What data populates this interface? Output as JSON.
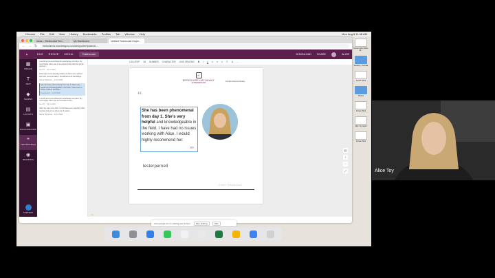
{
  "menubar": {
    "items": [
      "Chrome",
      "File",
      "Edit",
      "View",
      "History",
      "Bookmarks",
      "Profiles",
      "Tab",
      "Window",
      "Help"
    ],
    "clock": "Mon Aug 8 11:48 AM"
  },
  "browser": {
    "tabs": [
      "Ideas – Testimonial Tem...",
      "My Dashboard",
      "Untitled Testimonial Graph..."
    ],
    "url": "berkshirehs.maxdesigns.com/designs/template/d1..."
  },
  "app": {
    "menu": [
      "DNS",
      "RESIZE",
      "MEDIA"
    ],
    "design_name": "Testimonial",
    "right": [
      "DOWNLOAD",
      "SHARE",
      "ALICE"
    ]
  },
  "rail": {
    "items": [
      "IMAGES",
      "TEXT",
      "SHAPES",
      "LAYOUTS",
      "BACKGROUNDS",
      "TESTIMONIALS",
      "BRANDING"
    ],
    "active": "TESTIMONIALS",
    "bottom": "SUPPORT"
  },
  "panel": {
    "items": [
      {
        "text": "I would recommend Berkshire Hathaway and Alice Toy most highly. Alice was a tremendous help with the whole process...",
        "meta": "Jane R. · Jul 14 2022"
      },
      {
        "text": "Alice is the most amazing realtor we have ever worked with! Her communication, friendliness and knowledge...",
        "meta": "Sasha Hightower · Jul 19 2022"
      },
      {
        "text": "She has been phenomenal from day 1. She's very helpful and knowledgeable in the field. I have had no issues working with Alice.",
        "meta": "lesterpernell · Jul 19 2022"
      },
      {
        "text": "I would recommend Berkshire Hathaway and Alice Toy most highly. Alice was a tremendous help...",
        "meta": "Jane R. · Jul 14 2022"
      },
      {
        "text": "Alice Toy was more than I could have ever expected. After meeting she got us a home in 2 weeks...",
        "meta": "Sasha Hightower · Jul 19 2022"
      }
    ]
  },
  "toolbar": {
    "font": "LOLLIPOP",
    "size": "36",
    "fields": [
      "NUMBER",
      "CHARACTER",
      "LINE SPACING"
    ]
  },
  "card": {
    "brand_name": "BERKSHIRE HATHAWAY",
    "brand_sub": "HOMESERVICES",
    "agent": "Florida Network Realty",
    "quote_bold": "She has been phenomenal from day 1. She's very helpful",
    "quote_rest": " and knowledgeable in the field. I have had no issues working with Alice. I would highly recommend her.",
    "signer": "lesterpernell",
    "footer_label": "Client Testimonial"
  },
  "sharebar": {
    "text": "www.google.com is sharing your screen.",
    "stop": "Stop sharing",
    "hide": "Hide"
  },
  "desktop": {
    "items": [
      "Screen Shot 2022-08...",
      "Desktop - Kendall",
      "Screen Shot",
      "Photos",
      "Screen Shot",
      "Alice Toy Agent",
      "Screen Shot"
    ]
  },
  "webcam": {
    "name": "Alice Toy"
  },
  "colors": {
    "brand_plum": "#5c1f4e",
    "rail_dark": "#341530",
    "quote_mark": "#b38aa6"
  }
}
